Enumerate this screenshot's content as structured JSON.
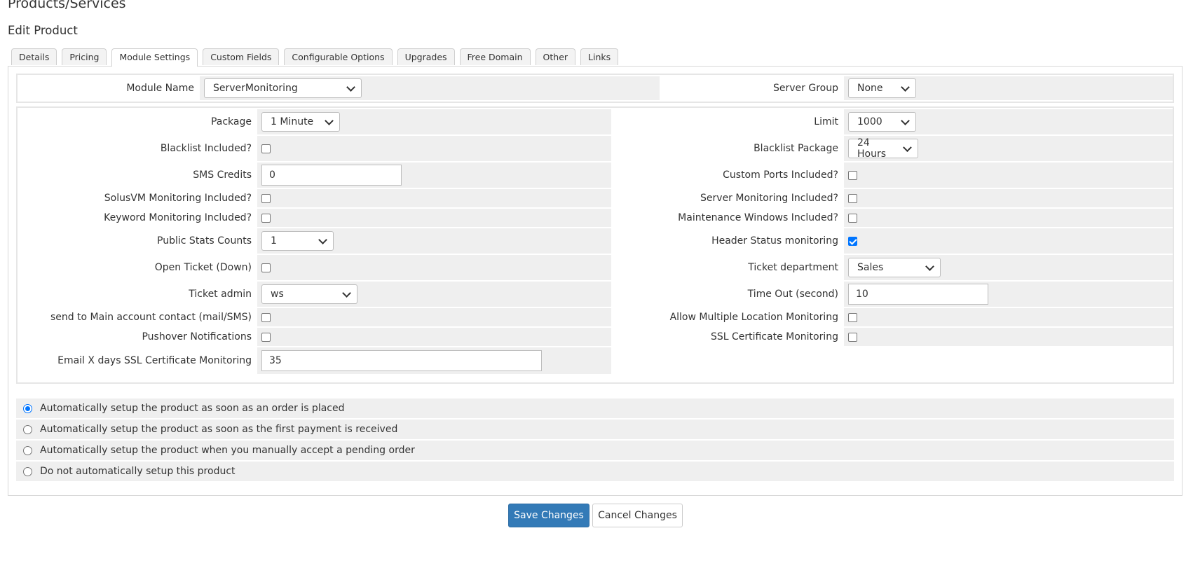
{
  "page": {
    "title": "Products/Services",
    "subtitle": "Edit Product"
  },
  "tabs": [
    "Details",
    "Pricing",
    "Module Settings",
    "Custom Fields",
    "Configurable Options",
    "Upgrades",
    "Free Domain",
    "Other",
    "Links"
  ],
  "active_tab": "Module Settings",
  "module": {
    "name_label": "Module Name",
    "name_value": "ServerMonitoring",
    "group_label": "Server Group",
    "group_value": "None"
  },
  "settings": {
    "package_label": "Package",
    "package_value": "1 Minute",
    "limit_label": "Limit",
    "limit_value": "1000",
    "blacklist_included_label": "Blacklist Included?",
    "blacklist_included_checked": false,
    "blacklist_package_label": "Blacklist Package",
    "blacklist_package_value": "24 Hours",
    "sms_credits_label": "SMS Credits",
    "sms_credits_value": "0",
    "custom_ports_label": "Custom Ports Included?",
    "custom_ports_checked": false,
    "solusvm_label": "SolusVM Monitoring Included?",
    "solusvm_checked": false,
    "server_monitoring_label": "Server Monitoring Included?",
    "server_monitoring_checked": false,
    "keyword_label": "Keyword Monitoring Included?",
    "keyword_checked": false,
    "maintenance_label": "Maintenance Windows Included?",
    "maintenance_checked": false,
    "public_stats_label": "Public Stats Counts",
    "public_stats_value": "1",
    "header_status_label": "Header Status monitoring",
    "header_status_checked": true,
    "open_ticket_label": "Open Ticket (Down)",
    "open_ticket_checked": false,
    "ticket_department_label": "Ticket department",
    "ticket_department_value": "Sales",
    "ticket_admin_label": "Ticket admin",
    "ticket_admin_value": "ws",
    "timeout_label": "Time Out (second)",
    "timeout_value": "10",
    "send_main_label": "send to Main account contact (mail/SMS)",
    "send_main_checked": false,
    "multi_location_label": "Allow Multiple Location Monitoring",
    "multi_location_checked": false,
    "pushover_label": "Pushover Notifications",
    "pushover_checked": false,
    "ssl_cert_label": "SSL Certificate Monitoring",
    "ssl_cert_checked": false,
    "email_ssl_label": "Email X days SSL Certificate Monitoring",
    "email_ssl_value": "35"
  },
  "autosetup": {
    "options": [
      "Automatically setup the product as soon as an order is placed",
      "Automatically setup the product as soon as the first payment is received",
      "Automatically setup the product when you manually accept a pending order",
      "Do not automatically setup this product"
    ],
    "selected_index": 0
  },
  "buttons": {
    "save": "Save Changes",
    "cancel": "Cancel Changes"
  },
  "colors": {
    "primary": "#337ab7",
    "field_bg": "#efefef",
    "checkbox_checked": "#0075ff"
  }
}
